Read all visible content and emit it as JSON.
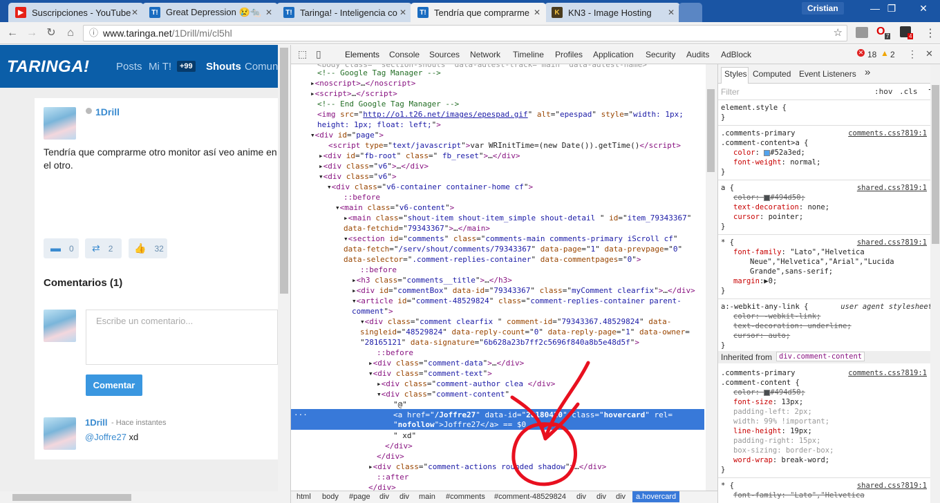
{
  "browser": {
    "tabs": [
      {
        "title": "Suscripciones - YouTube",
        "favicon": "youtube-icon"
      },
      {
        "title": "Great Depression 😢🐀",
        "favicon": "taringa-icon"
      },
      {
        "title": "Taringa! - Inteligencia co",
        "favicon": "taringa-icon"
      },
      {
        "title": "Tendría que comprarme",
        "favicon": "taringa-icon"
      },
      {
        "title": "KN3 - Image Hosting",
        "favicon": "kn3-icon"
      }
    ],
    "user": "Cristian",
    "url_host": "www.taringa.net",
    "url_path": "/1Drill/mi/cl5hl",
    "ext_badge_1": "7",
    "ext_badge_2": "4"
  },
  "site": {
    "logo": "TARINGA!",
    "nav": [
      "Posts",
      "Mi T!",
      "+99",
      "Shouts",
      "Comun"
    ],
    "author": "1Drill",
    "shout_text_1": "Tendría que comprarme otro monitor así veo anime en u",
    "shout_text_2": "el otro.",
    "stats": {
      "comments": "0",
      "reshares": "2",
      "likes": "32"
    },
    "comments_title": "Comentarios (1)",
    "comment_placeholder": "Escribe un comentario...",
    "comment_button": "Comentar",
    "comment": {
      "author": "1Drill",
      "time": "- Hace instantes",
      "mention": "@Joffre27",
      "text": " xd"
    }
  },
  "devtools": {
    "tabs": [
      "Elements",
      "Console",
      "Sources",
      "Network",
      "Timeline",
      "Profiles",
      "Application",
      "Security",
      "Audits",
      "AdBlock"
    ],
    "errors": "18",
    "warnings": "2",
    "breadcrumbs": [
      "html",
      "body",
      "#page",
      "div",
      "div",
      "main",
      "#comments",
      "#comment-48529824",
      "div",
      "div",
      "div",
      "a.hovercard"
    ],
    "styles_tabs": [
      "Styles",
      "Computed",
      "Event Listeners"
    ],
    "filter_placeholder": "Filter",
    "hov": ":hov",
    "cls": ".cls",
    "inherited_label": "Inherited from",
    "inherited_from": "div.comment-content"
  },
  "colors": {
    "taringa_blue": "#0b5ea8",
    "selection": "#3879d9",
    "annotation": "#e8101f",
    "link": "#52a3ed"
  }
}
